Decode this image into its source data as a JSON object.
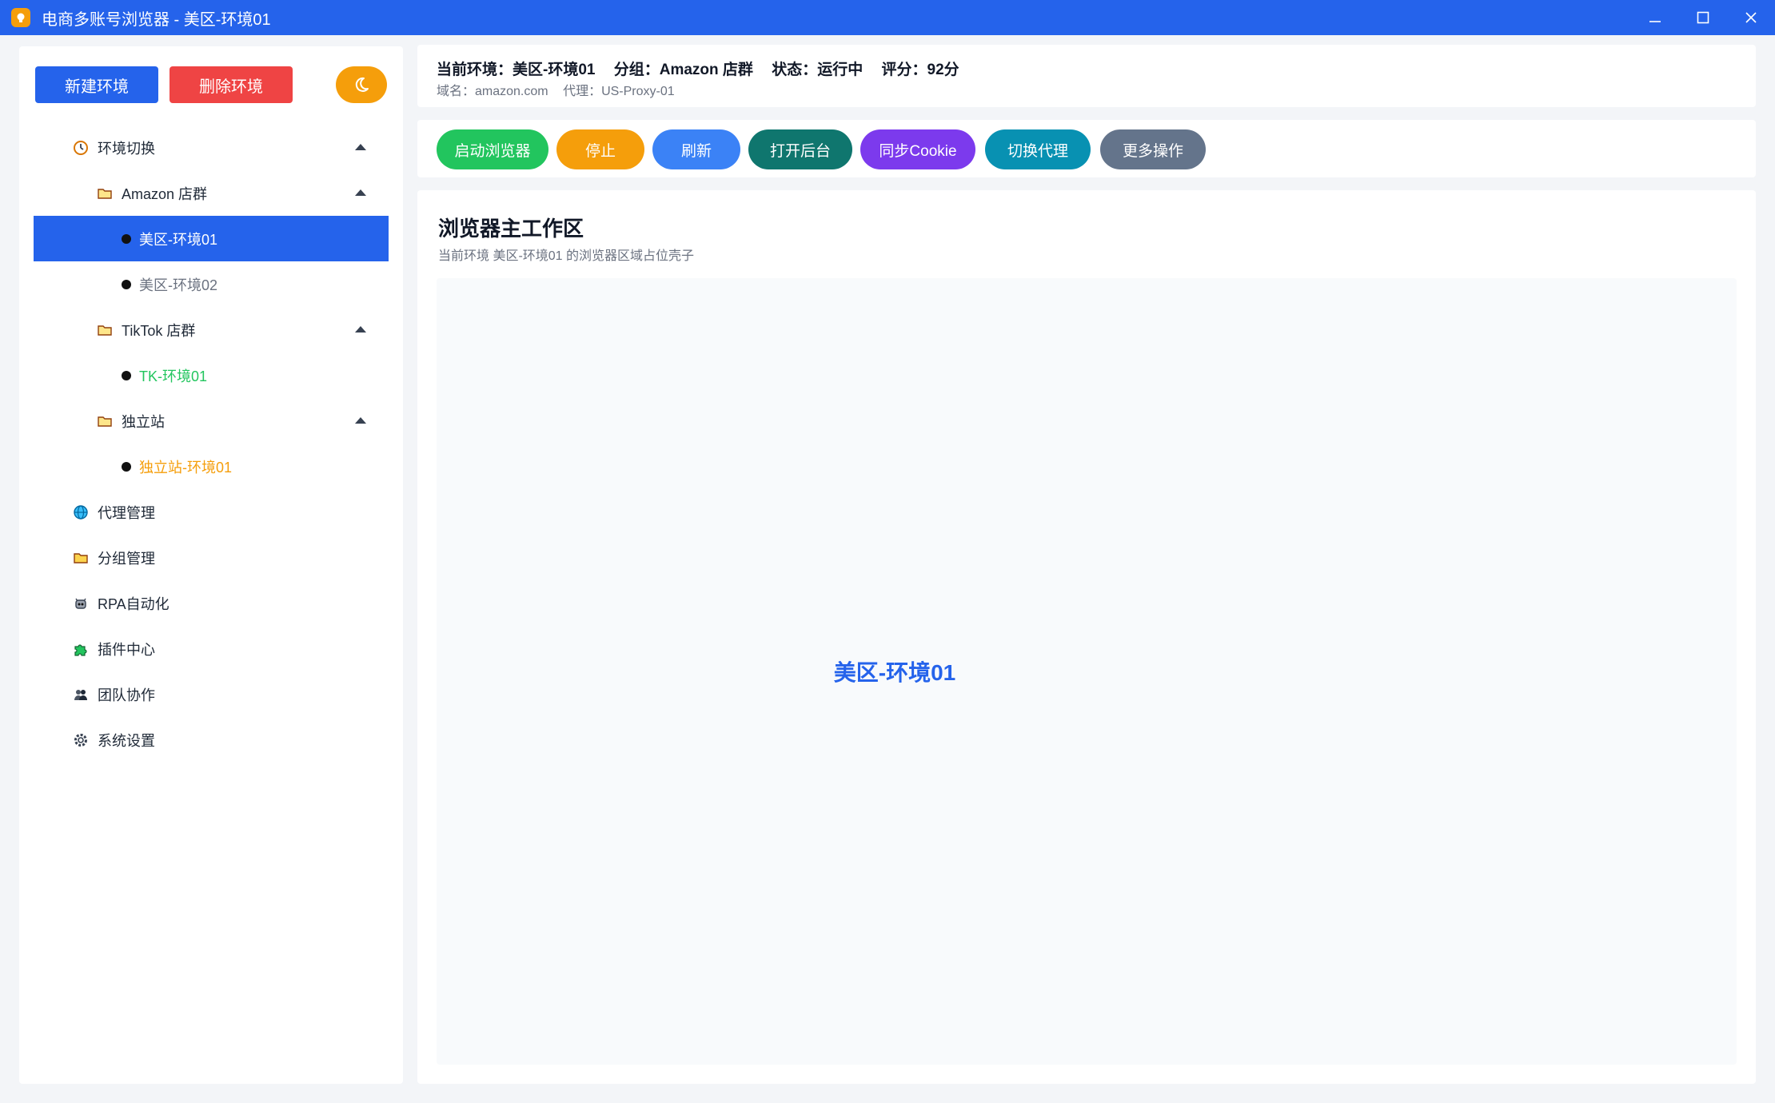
{
  "window": {
    "title": "电商多账号浏览器 - 美区-环境01"
  },
  "sidebar": {
    "new_label": "新建环境",
    "delete_label": "删除环境",
    "theme_icon": "moon-icon",
    "items": [
      {
        "label": "环境切换",
        "icon": "clock-icon"
      },
      {
        "label": "Amazon 店群",
        "icon": "folder-icon"
      },
      {
        "label": "美区-环境01",
        "selected": true
      },
      {
        "label": "美区-环境02"
      },
      {
        "label": "TikTok 店群",
        "icon": "folder-icon"
      },
      {
        "label": "TK-环境01"
      },
      {
        "label": "独立站",
        "icon": "folder-icon"
      },
      {
        "label": "独立站-环境01"
      },
      {
        "label": "代理管理",
        "icon": "globe-icon"
      },
      {
        "label": "分组管理",
        "icon": "folder-icon"
      },
      {
        "label": "RPA自动化",
        "icon": "robot-icon"
      },
      {
        "label": "插件中心",
        "icon": "puzzle-icon"
      },
      {
        "label": "团队协作",
        "icon": "team-icon"
      },
      {
        "label": "系统设置",
        "icon": "gear-icon"
      }
    ]
  },
  "info": {
    "current_env": "当前环境：美区-环境01",
    "group": "分组：Amazon 店群",
    "status": "状态：运行中",
    "score": "评分：92分",
    "domain": "域名：amazon.com",
    "proxy": "代理：US-Proxy-01"
  },
  "actions": [
    {
      "label": "启动浏览器",
      "color": "#22c55e"
    },
    {
      "label": "停止",
      "color": "#f59e0b"
    },
    {
      "label": "刷新",
      "color": "#3b82f6"
    },
    {
      "label": "打开后台",
      "color": "#0f766e"
    },
    {
      "label": "同步Cookie",
      "color": "#7c3aed"
    },
    {
      "label": "切换代理",
      "color": "#0891b2"
    },
    {
      "label": "更多操作",
      "color": "#64748b"
    }
  ],
  "workspace": {
    "title": "浏览器主工作区",
    "subtitle": "当前环境 美区-环境01 的浏览器区域占位壳子",
    "center_label": "美区-环境01"
  },
  "colors": {
    "accent": "#2563eb",
    "danger": "#ef4444",
    "warning": "#f59e0b"
  }
}
